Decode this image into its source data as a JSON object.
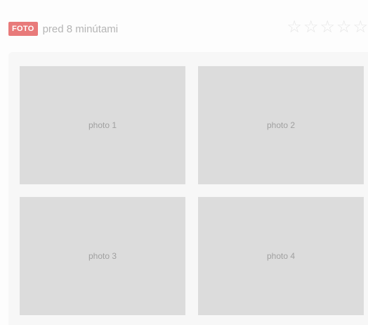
{
  "header": {
    "badge": "FOTO",
    "time": "pred 8 minútami"
  },
  "rating": {
    "stars": [
      "☆",
      "☆",
      "☆",
      "☆",
      "☆"
    ]
  },
  "gallery": {
    "items": [
      {
        "label": "photo 1"
      },
      {
        "label": "photo 2"
      },
      {
        "label": "photo 3"
      },
      {
        "label": "photo 4"
      }
    ]
  }
}
